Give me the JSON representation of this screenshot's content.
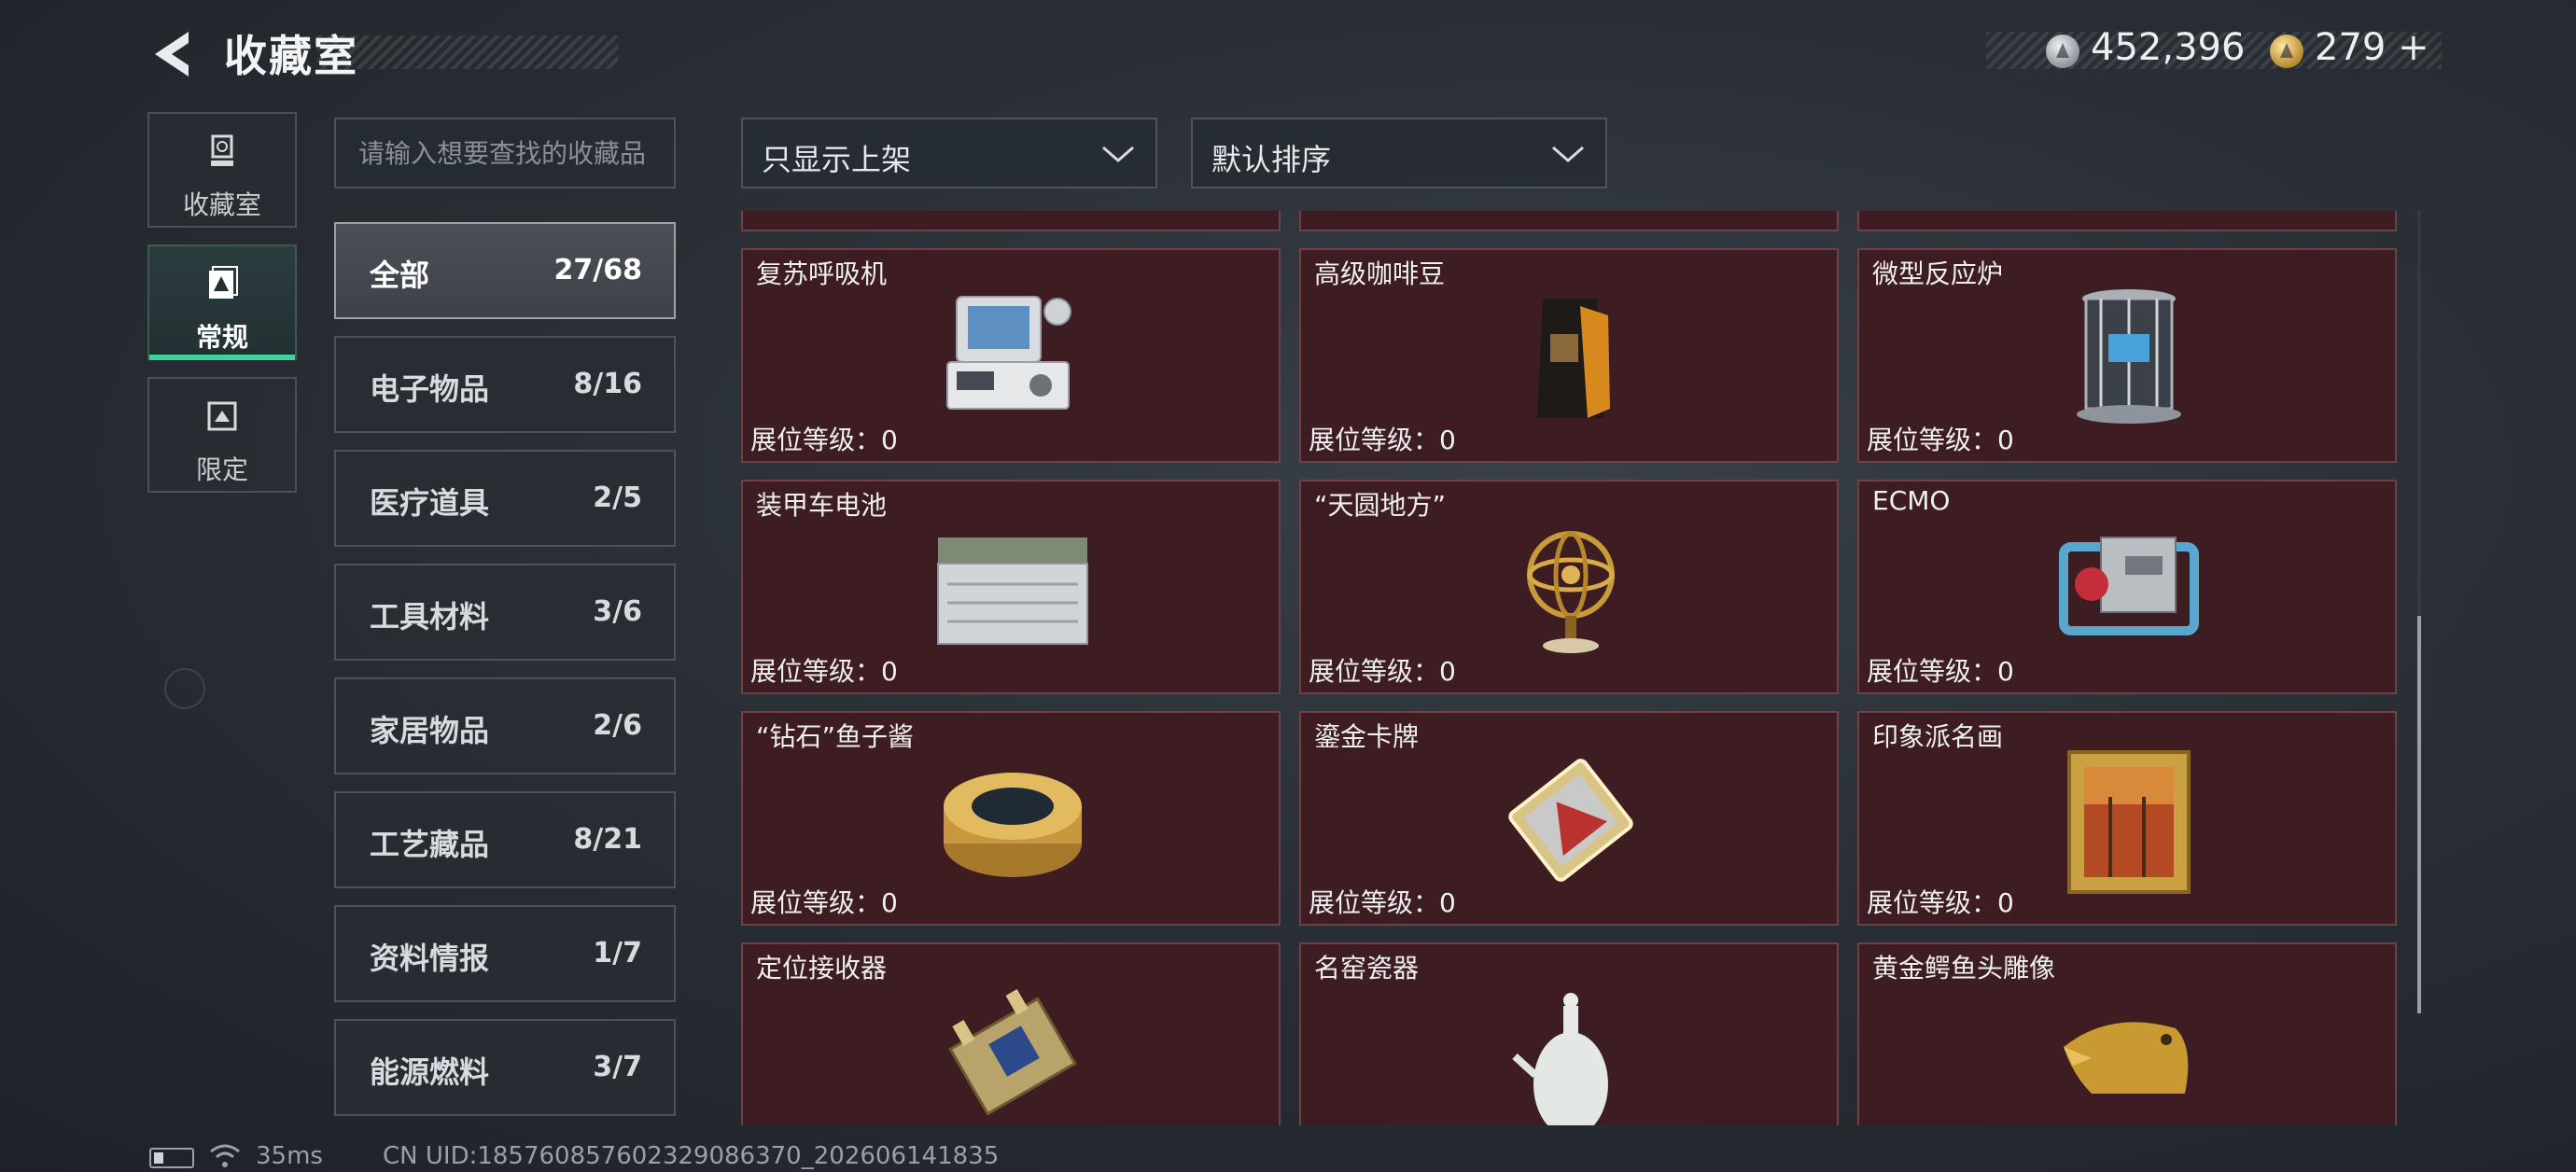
{
  "header": {
    "title": "收藏室",
    "currency_silver": "452,396",
    "currency_gold": "279",
    "currency_gold_plus": "+"
  },
  "rail": [
    {
      "label": "收藏室",
      "icon": "trophy-icon",
      "active": false
    },
    {
      "label": "常规",
      "icon": "card-icon",
      "active": true
    },
    {
      "label": "限定",
      "icon": "limited-icon",
      "active": false
    }
  ],
  "search": {
    "placeholder": "请输入想要查找的收藏品"
  },
  "filters": {
    "shelf_filter": "只显示上架",
    "sort": "默认排序"
  },
  "categories": [
    {
      "name": "全部",
      "count": "27/68",
      "active": true
    },
    {
      "name": "电子物品",
      "count": "8/16"
    },
    {
      "name": "医疗道具",
      "count": "2/5"
    },
    {
      "name": "工具材料",
      "count": "3/6"
    },
    {
      "name": "家居物品",
      "count": "2/6"
    },
    {
      "name": "工艺藏品",
      "count": "8/21"
    },
    {
      "name": "资料情报",
      "count": "1/7"
    },
    {
      "name": "能源燃料",
      "count": "3/7"
    }
  ],
  "level_label": "展位等级：",
  "items": [
    {
      "name": "复苏呼吸机",
      "level": "0",
      "icon": "ventilator-icon"
    },
    {
      "name": "高级咖啡豆",
      "level": "0",
      "icon": "coffee-bag-icon"
    },
    {
      "name": "微型反应炉",
      "level": "0",
      "icon": "reactor-icon"
    },
    {
      "name": "装甲车电池",
      "level": "0",
      "icon": "battery-icon"
    },
    {
      "name": "“天圆地方”",
      "level": "0",
      "icon": "armillary-sphere-icon"
    },
    {
      "name": "ECMO",
      "level": "0",
      "icon": "ecmo-icon"
    },
    {
      "name": "“钻石”鱼子酱",
      "level": "0",
      "icon": "caviar-tin-icon"
    },
    {
      "name": "鎏金卡牌",
      "level": "0",
      "icon": "gold-card-icon"
    },
    {
      "name": "印象派名画",
      "level": "0",
      "icon": "painting-icon"
    },
    {
      "name": "定位接收器",
      "level": "",
      "icon": "gps-receiver-icon"
    },
    {
      "name": "名窑瓷器",
      "level": "",
      "icon": "porcelain-vase-icon"
    },
    {
      "name": "黄金鳄鱼头雕像",
      "level": "",
      "icon": "crocodile-statue-icon"
    }
  ],
  "footer": {
    "ping": "35ms",
    "uid": "CN UID:1857608576023290863​70_202606141835"
  }
}
